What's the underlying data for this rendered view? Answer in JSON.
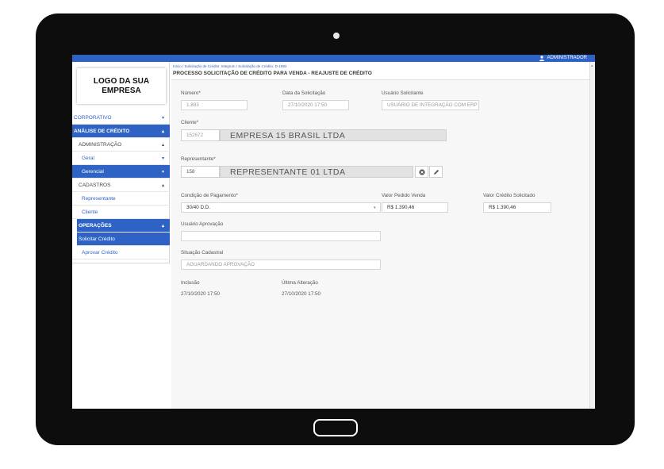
{
  "header": {
    "user": "ADMINISTRADOR"
  },
  "logo": {
    "line1": "LOGO DA SUA",
    "line2": "EMPRESA"
  },
  "sidebar": {
    "corporativo": "CORPORATIVO",
    "analise": "ANÁLISE DE CRÉDITO",
    "administracao": "ADMINISTRAÇÃO",
    "geral": "Geral",
    "gerencial": "Gerencial",
    "cadastros": "CADASTROS",
    "representante": "Representante",
    "cliente": "Cliente",
    "operacoes": "OPERAÇÕES",
    "solicitar": "Solicitar Crédito",
    "aprovar": "Aprovar Crédito",
    "chev_down": "▾",
    "chev_up": "▴"
  },
  "breadcrumb": "Início  /  Solicitação de Crédito: Integrum  /  Solicitação de Crédito: D-1893",
  "page_title": "PROCESSO SOLICITAÇÃO DE CRÉDITO PARA VENDA - REAJUSTE DE CRÉDITO",
  "form": {
    "numero_label": "Número*",
    "numero_value": "1.893",
    "data_label": "Data da Solicitação",
    "data_value": "27/10/2020 17:50",
    "usuario_label": "Usuário Solicitante",
    "usuario_value": "USUÁRIO DE INTEGRAÇÃO COM ERP",
    "cliente_label": "Cliente*",
    "cliente_id": "152672",
    "cliente_name": "EMPRESA 15 BRASIL LTDA",
    "rep_label": "Representante*",
    "rep_id": "158",
    "rep_name": "REPRESENTANTE 01 LTDA",
    "condicao_label": "Condição de Pagamento*",
    "condicao_value": "30/40 D.D.",
    "valor_pedido_label": "Valor Pedido Venda",
    "valor_pedido_value": "R$ 1.390,46",
    "valor_credito_label": "Valor Crédito Solicitado",
    "valor_credito_value": "R$ 1.390,46",
    "usuario_aprov_label": "Usuário Aprovação",
    "usuario_aprov_value": "",
    "situacao_label": "Situação Cadastral",
    "situacao_value": "AGUARDANDO APROVAÇÃO",
    "inclusao_label": "Inclusão",
    "inclusao_value": "27/10/2020 17:50",
    "ultima_label": "Última Alteração",
    "ultima_value": "27/10/2020 17:50"
  },
  "colors": {
    "accent": "#2e63c5",
    "tablet": "#0d0d0d"
  }
}
